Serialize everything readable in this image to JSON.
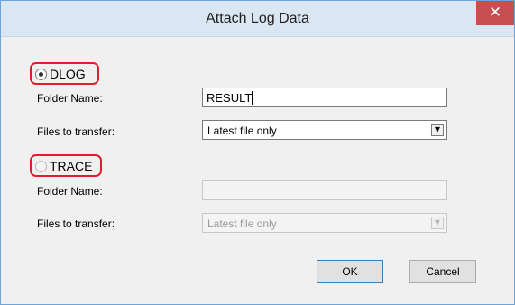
{
  "window": {
    "title": "Attach Log Data",
    "close_glyph": "✕"
  },
  "dlog": {
    "label": "DLOG",
    "selected": true,
    "folder_name_label": "Folder Name:",
    "folder_name_value": "RESULT",
    "files_label": "Files to transfer:",
    "files_value": "Latest file only"
  },
  "trace": {
    "label": "TRACE",
    "selected": false,
    "folder_name_label": "Folder Name:",
    "folder_name_value": "",
    "files_label": "Files to transfer:",
    "files_value": "Latest file only"
  },
  "buttons": {
    "ok": "OK",
    "cancel": "Cancel"
  },
  "colors": {
    "highlight": "#e01e2b",
    "close_button": "#c74f4f",
    "titlebar": "#dbe6f3"
  }
}
